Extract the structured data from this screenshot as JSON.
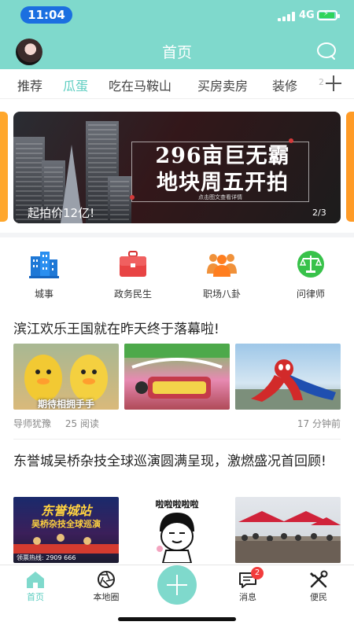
{
  "status_bar": {
    "time": "11:04",
    "network": "4G"
  },
  "header": {
    "title": "首页",
    "avatar_icon": "user-avatar",
    "search_icon": "search-icon"
  },
  "tabs": [
    {
      "label": "推荐",
      "active": false
    },
    {
      "label": "瓜蛋",
      "active": true
    },
    {
      "label": "吃在马鞍山",
      "active": false
    },
    {
      "label": "买房卖房",
      "active": false
    },
    {
      "label": "装修",
      "active": false
    }
  ],
  "tabs_more_glyph": "2",
  "banner": {
    "headline_line1": "296亩巨无霸",
    "headline_line2": "地块周五开拍",
    "hint": "点击图文查看详情",
    "caption": "起拍价12亿!",
    "page_indicator": "2/3"
  },
  "categories": [
    {
      "label": "城事",
      "icon": "city-buildings-icon"
    },
    {
      "label": "政务民生",
      "icon": "briefcase-icon"
    },
    {
      "label": "职场八卦",
      "icon": "people-group-icon"
    },
    {
      "label": "问律师",
      "icon": "scales-icon"
    }
  ],
  "feed": [
    {
      "title": "滨江欢乐王国就在昨天终于落幕啦!",
      "thumb_texts": [
        "期待相拥手手"
      ],
      "author": "导师犹豫",
      "reads": "25 阅读",
      "time": "17 分钟前"
    },
    {
      "title": "东誉城吴桥杂技全球巡演圆满呈现，激燃盛况首回顾!",
      "thumb_texts": [
        "东誉城站",
        "吴桥杂技全球巡演",
        "领票热线: 2909 666",
        "啦啦啦啦啦"
      ]
    }
  ],
  "bottom_nav": [
    {
      "label": "首页",
      "icon": "home-icon",
      "active": true
    },
    {
      "label": "本地圈",
      "icon": "camera-aperture-icon",
      "active": false
    },
    {
      "label": "",
      "icon": "plus-icon",
      "active": false
    },
    {
      "label": "消息",
      "icon": "message-icon",
      "active": false,
      "badge": "2"
    },
    {
      "label": "便民",
      "icon": "tools-icon",
      "active": false
    }
  ],
  "colors": {
    "brand": "#7fd9cc",
    "accent": "#5ccdc0",
    "badge": "#f23c3c",
    "time_pill": "#1b6fe0"
  }
}
